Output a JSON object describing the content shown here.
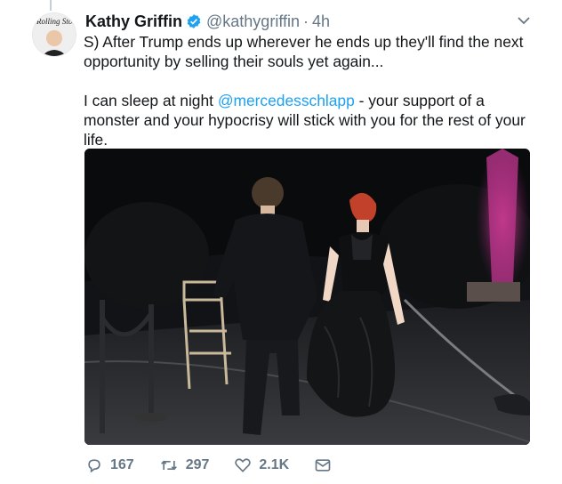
{
  "tweet": {
    "author_name": "Kathy Griffin",
    "handle": "@kathygriffin",
    "separator": "·",
    "time": "4h",
    "text_line1": "S) After Trump ends up wherever he ends up they'll find the next opportunity by selling their souls yet again...",
    "text_line2_before": "I can sleep at night ",
    "mention": "@mercedesschlapp",
    "text_line2_after": " - your support of a monster and your hypocrisy will stick with you for the rest of your life.",
    "avatar_text": "Rolling Stone"
  },
  "actions": {
    "replies": "167",
    "retweets": "297",
    "likes": "2.1K"
  },
  "colors": {
    "accent": "#1da1f2",
    "muted": "#657786",
    "text": "#14171a"
  },
  "icons": [
    "verified-badge-icon",
    "chevron-down-icon",
    "reply-icon",
    "retweet-icon",
    "like-icon",
    "dm-icon"
  ]
}
